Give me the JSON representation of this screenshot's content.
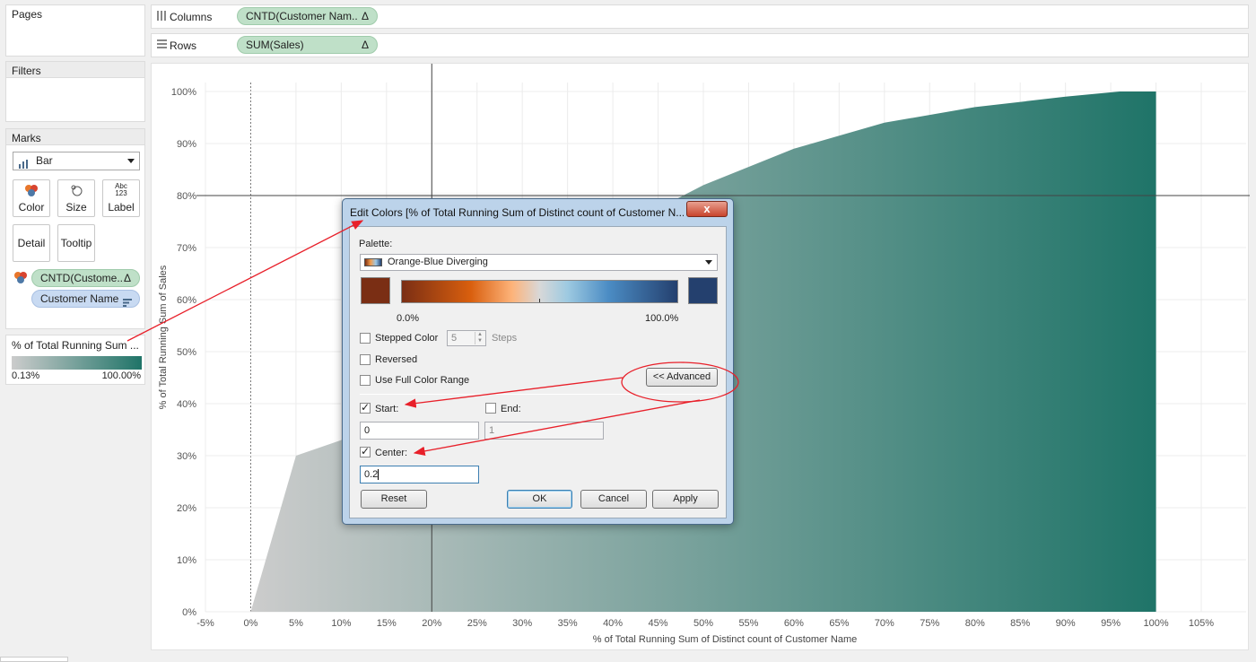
{
  "cards": {
    "pages": {
      "title": "Pages"
    },
    "filters": {
      "title": "Filters"
    },
    "marks": {
      "title": "Marks",
      "mark_type": "Bar",
      "buttons": {
        "color": "Color",
        "size": "Size",
        "label": "Label",
        "detail": "Detail",
        "tooltip": "Tooltip"
      },
      "label_icon_text": "Abc\n123",
      "pills": [
        {
          "text": "CNTD(Custome..",
          "suffix": "Δ"
        },
        {
          "text": "Customer Name",
          "suffix": ""
        }
      ]
    },
    "legend": {
      "title": "% of Total Running Sum ...",
      "min": "0.13%",
      "max": "100.00%"
    }
  },
  "shelves": {
    "columns": {
      "label": "Columns",
      "pill": "CNTD(Customer Nam..",
      "delta": "Δ"
    },
    "rows": {
      "label": "Rows",
      "pill": "SUM(Sales)",
      "delta": "Δ"
    }
  },
  "chart_data": {
    "type": "area",
    "xlabel": "% of Total Running Sum of Distinct count of Customer Name",
    "ylabel": "% of Total Running Sum of Sales",
    "x_ticks": [
      "-5%",
      "0%",
      "5%",
      "10%",
      "15%",
      "20%",
      "25%",
      "30%",
      "35%",
      "40%",
      "45%",
      "50%",
      "55%",
      "60%",
      "65%",
      "70%",
      "75%",
      "80%",
      "85%",
      "90%",
      "95%",
      "100%",
      "105%"
    ],
    "y_ticks": [
      "0%",
      "10%",
      "20%",
      "30%",
      "40%",
      "50%",
      "60%",
      "70%",
      "80%",
      "90%",
      "100%"
    ],
    "xlim": [
      -5,
      105
    ],
    "ylim": [
      0,
      100
    ],
    "reference_lines": {
      "x": 20,
      "y": 80
    },
    "x": [
      0,
      5,
      10,
      20,
      30,
      40,
      50,
      60,
      70,
      80,
      90,
      96,
      100
    ],
    "y": [
      0,
      30,
      33,
      48,
      62,
      73,
      82,
      89,
      94,
      97,
      99,
      100,
      100
    ],
    "color_start": "#cccccc",
    "color_end": "#1f7468"
  },
  "dialog": {
    "title": "Edit Colors [% of Total Running Sum of Distinct count of Customer N...",
    "close": "x",
    "palette_label": "Palette:",
    "palette_value": "Orange-Blue Diverging",
    "range_min": "0.0%",
    "range_max": "100.0%",
    "stepped_color": "Stepped Color",
    "steps_value": "5",
    "steps_label": "Steps",
    "reversed": "Reversed",
    "use_full_range": "Use Full Color Range",
    "advanced": "<< Advanced",
    "start_label": "Start:",
    "end_label": "End:",
    "start_value": "0",
    "end_value": "1",
    "center_label": "Center:",
    "center_value": "0.2",
    "reset": "Reset",
    "ok": "OK",
    "cancel": "Cancel",
    "apply": "Apply",
    "colors": {
      "orange": "#7a2e14",
      "blue": "#24406e"
    }
  }
}
